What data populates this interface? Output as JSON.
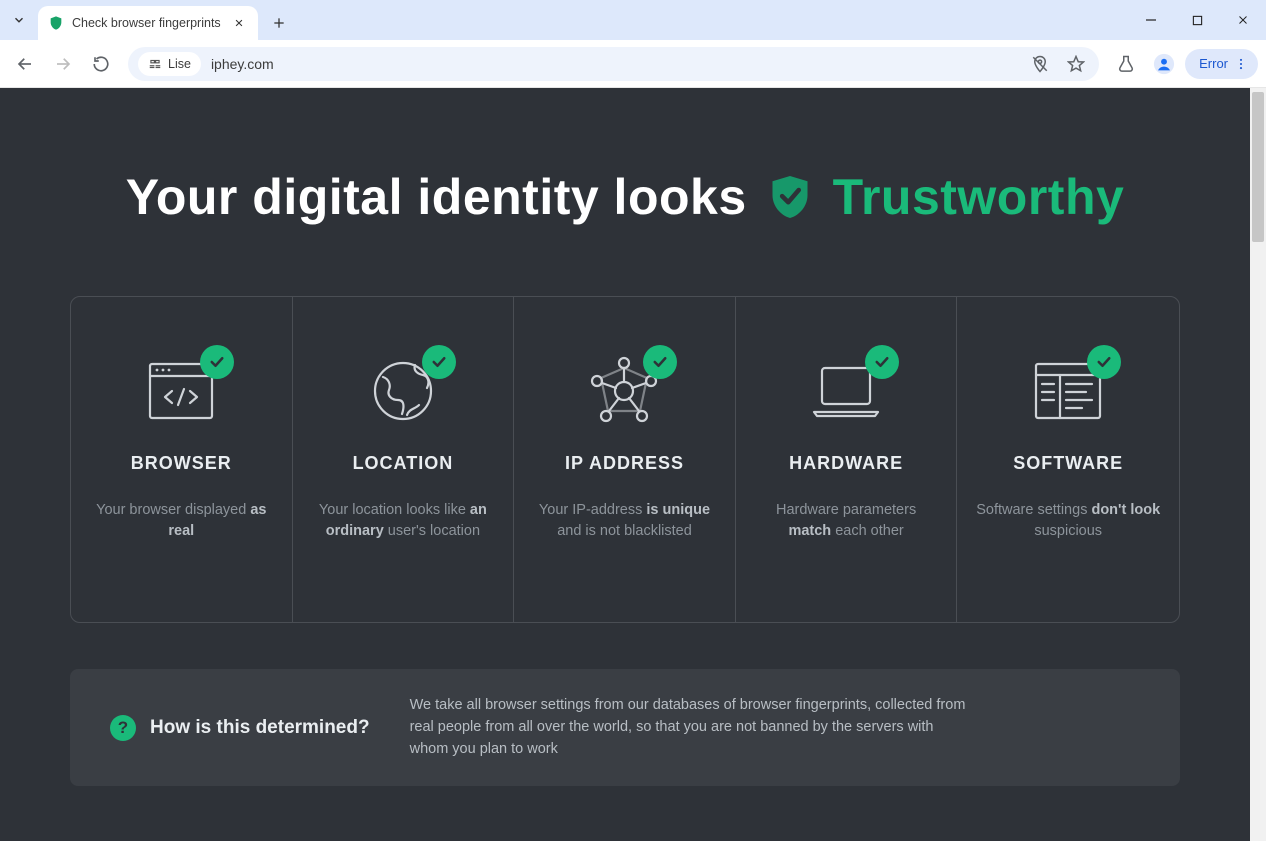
{
  "browser": {
    "tab_title": "Check browser fingerprints",
    "profile_chip": "Lise",
    "url": "iphey.com",
    "error_label": "Error"
  },
  "hero": {
    "prefix": "Your digital identity looks",
    "status": "Trustworthy"
  },
  "cards": [
    {
      "title": "BROWSER",
      "text_pre": "Your browser displayed ",
      "bold": "as real",
      "text_post": ""
    },
    {
      "title": "LOCATION",
      "text_pre": "Your location looks like ",
      "bold": "an ordinary",
      "text_post": " user's location"
    },
    {
      "title": "IP ADDRESS",
      "text_pre": "Your IP-address ",
      "bold": "is unique",
      "text_post": " and is not blacklisted"
    },
    {
      "title": "HARDWARE",
      "text_pre": "Hardware parameters ",
      "bold": "match",
      "text_post": " each other"
    },
    {
      "title": "SOFTWARE",
      "text_pre": "Software settings ",
      "bold": "don't look",
      "text_post": " suspicious"
    }
  ],
  "info": {
    "question": "How is this determined?",
    "answer": "We take all browser settings from our databases of browser fingerprints, collected from real people from all over the world, so that you are not banned by the servers with whom you plan to work"
  }
}
